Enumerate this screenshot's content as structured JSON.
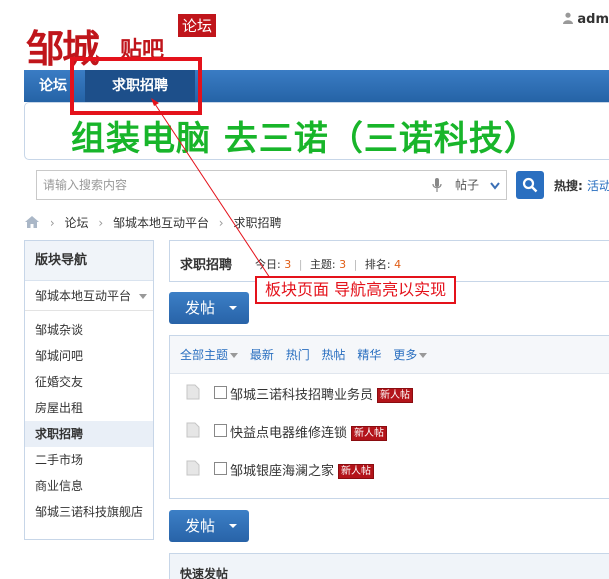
{
  "header": {
    "logo_main": "邹城",
    "logo_sub": "贴吧",
    "logo_badge": "论坛",
    "username": "adm"
  },
  "nav": {
    "items": [
      {
        "label": "论坛"
      },
      {
        "label": "求职招聘"
      }
    ]
  },
  "banner": {
    "text": "组装电脑 去三诺（三诺科技）"
  },
  "search": {
    "placeholder": "请输入搜索内容",
    "type": "帖子",
    "hot_label": "热搜:",
    "hot_link": "活动"
  },
  "breadcrumb": {
    "items": [
      "论坛",
      "邹城本地互动平台",
      "求职招聘"
    ]
  },
  "sidebar": {
    "title": "版块导航",
    "group": "邹城本地互动平台",
    "items": [
      "邹城杂谈",
      "邹城问吧",
      "征婚交友",
      "房屋出租",
      "求职招聘",
      "二手市场",
      "商业信息",
      "邹城三诺科技旗舰店"
    ]
  },
  "forum": {
    "title": "求职招聘",
    "today_label": "今日:",
    "today": "3",
    "threads_label": "主题:",
    "threads": "3",
    "rank_label": "排名:",
    "rank": "4"
  },
  "post_button": "发帖",
  "filters": [
    "全部主题",
    "最新",
    "热门",
    "热帖",
    "精华",
    "更多"
  ],
  "threads": [
    {
      "title": "邹城三诺科技招聘业务员",
      "badge": "新人帖"
    },
    {
      "title": "快益点电器维修连锁",
      "badge": "新人帖"
    },
    {
      "title": "邹城银座海澜之家",
      "badge": "新人帖"
    }
  ],
  "quick_post": "快速发帖",
  "annotation": "板块页面 导航高亮以实现",
  "colors": {
    "nav_blue": "#2b6cb0",
    "logo_red": "#c0151b",
    "banner_green": "#18b52a",
    "annotation_red": "#e4121b",
    "count_orange": "#e05d16"
  }
}
